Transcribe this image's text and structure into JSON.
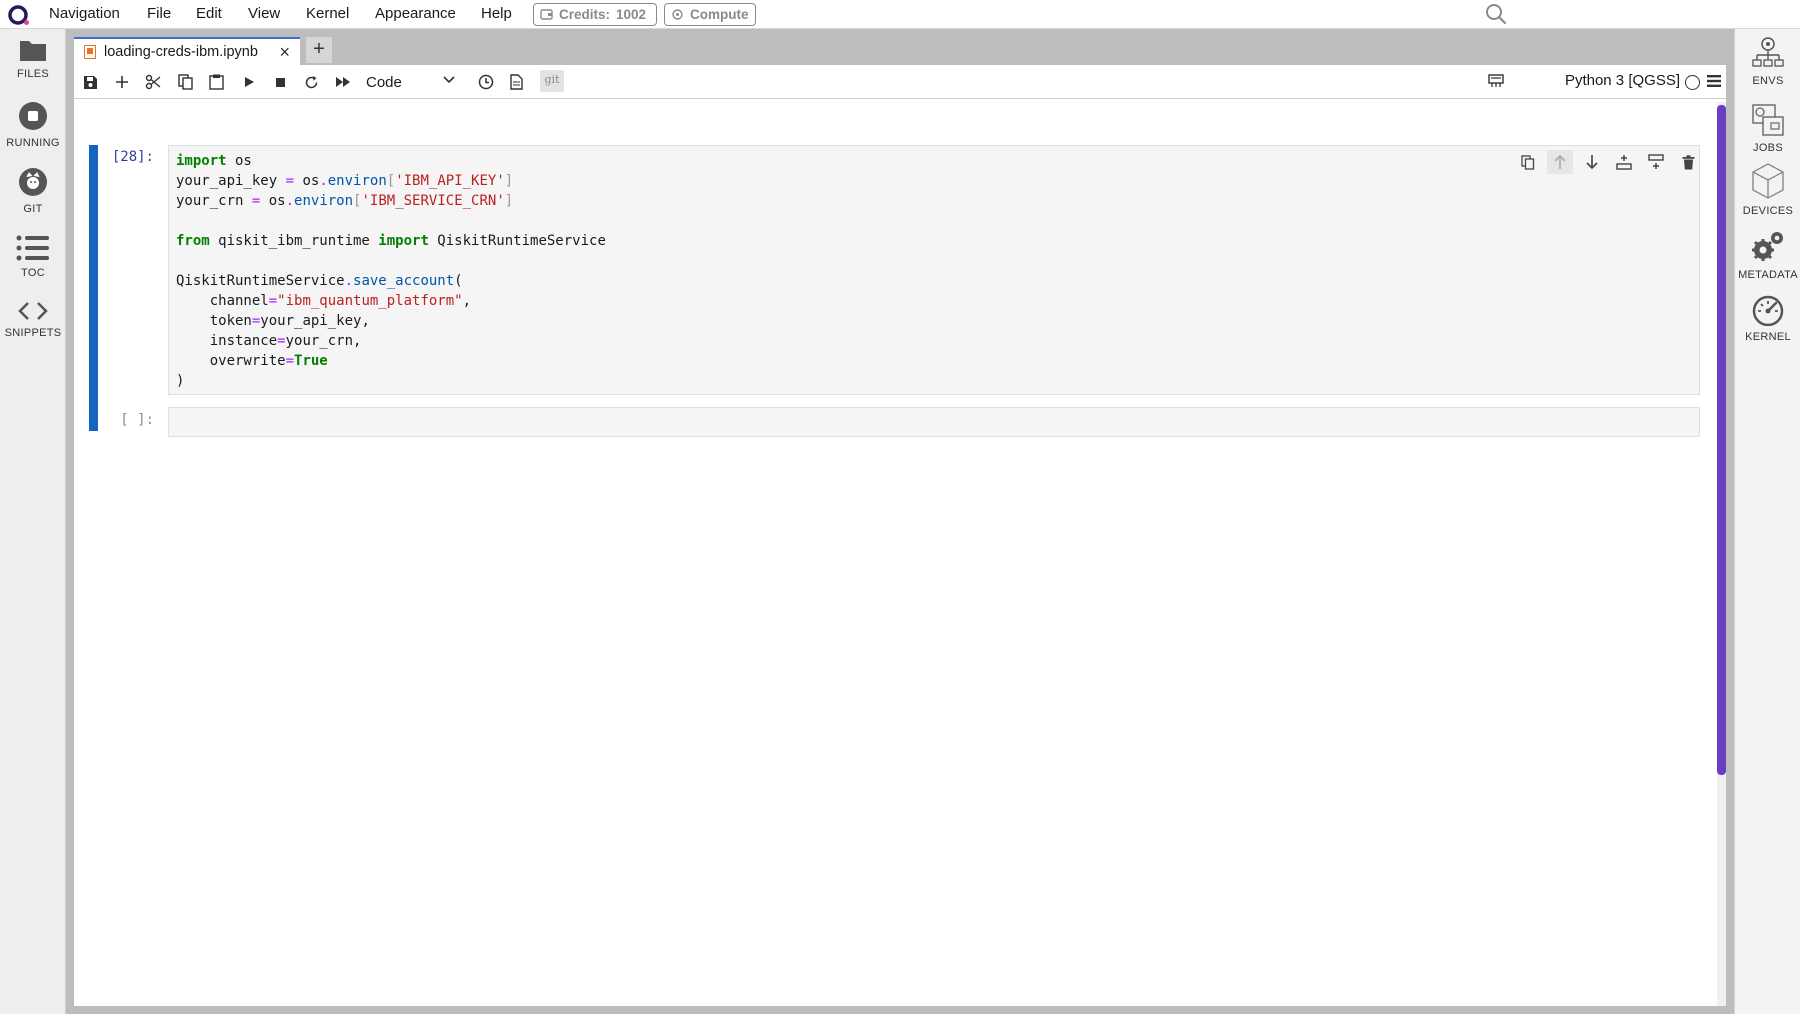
{
  "menubar": {
    "items": [
      "Navigation",
      "File",
      "Edit",
      "View",
      "Kernel",
      "Appearance",
      "Help"
    ],
    "credits_label": "Credits:",
    "credits_value": "1002",
    "compute_label": "Compute"
  },
  "left_sidebar": {
    "items": [
      {
        "label": "FILES",
        "icon": "folder-icon"
      },
      {
        "label": "RUNNING",
        "icon": "stop-circle-icon"
      },
      {
        "label": "GIT",
        "icon": "github-icon"
      },
      {
        "label": "TOC",
        "icon": "list-icon"
      },
      {
        "label": "SNIPPETS",
        "icon": "code-brackets-icon"
      }
    ]
  },
  "right_sidebar": {
    "items": [
      {
        "label": "ENVS",
        "icon": "environment-icon"
      },
      {
        "label": "JOBS",
        "icon": "jobs-icon"
      },
      {
        "label": "DEVICES",
        "icon": "cube-icon"
      },
      {
        "label": "METADATA",
        "icon": "gears-icon"
      },
      {
        "label": "KERNEL",
        "icon": "gauge-icon"
      }
    ]
  },
  "tabs": {
    "active_tab": "loading-creds-ibm.ipynb",
    "new_tab_glyph": "+"
  },
  "toolbar": {
    "cell_type": "Code",
    "git_label": "git",
    "kernel_name": "Python 3 [QGSS]"
  },
  "cells": [
    {
      "prompt": "[28]:"
    },
    {
      "prompt": "[ ]:"
    }
  ],
  "colors": {
    "accent_blue": "#1565c0",
    "scroll_purple": "#6a3fbf",
    "keyword_green": "#008000",
    "string_red": "#ba2121"
  }
}
